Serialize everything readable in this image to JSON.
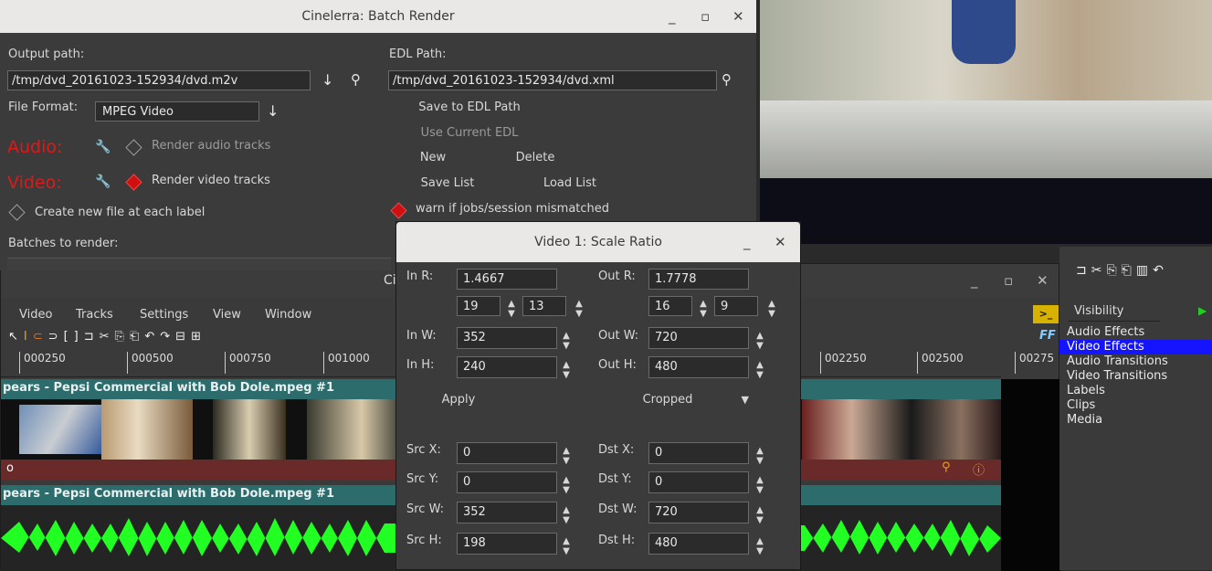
{
  "batch": {
    "title": "Cinelerra: Batch Render",
    "output_label": "Output path:",
    "output_path": "/tmp/dvd_20161023-152934/dvd.m2v",
    "edl_label": "EDL Path:",
    "edl_path": "/tmp/dvd_20161023-152934/dvd.xml",
    "format_label": "File Format:",
    "format_value": "MPEG Video",
    "audio_label": "Audio:",
    "render_audio": "Render audio tracks",
    "video_label": "Video:",
    "render_video": "Render video tracks",
    "create_label": "Create new file at each label",
    "batches_label": "Batches to render:",
    "save_edl": "Save to EDL Path",
    "use_current": "Use Current EDL",
    "new_btn": "New",
    "delete_btn": "Delete",
    "save_list": "Save List",
    "load_list": "Load List",
    "warn": "warn if jobs/session mismatched"
  },
  "main": {
    "title_fragment": "Ci",
    "menu": [
      "Video",
      "Tracks",
      "Settings",
      "View",
      "Window"
    ],
    "ruler_left": [
      "000250",
      "000500",
      "000750",
      "001000"
    ],
    "ruler_right": [
      "002250",
      "002500",
      "00275"
    ],
    "track1_title": "pears - Pepsi Commercial with Bob Dole.mpeg #1",
    "track2_title": "pears - Pepsi Commercial with Bob Dole.mpeg #1",
    "track_marker": "o"
  },
  "resources": {
    "tab": "Visibility",
    "items": [
      "Audio Effects",
      "Video Effects",
      "Audio Transitions",
      "Video Transitions",
      "Labels",
      "Clips",
      "Media"
    ],
    "selected": "Video Effects"
  },
  "scale": {
    "title": "Video 1: Scale Ratio",
    "in_r_label": "In R:",
    "in_r": "1.4667",
    "out_r_label": "Out R:",
    "out_r": "1.7778",
    "in_ra": "19",
    "in_rb": "13",
    "out_ra": "16",
    "out_rb": "9",
    "in_w_label": "In W:",
    "in_w": "352",
    "out_w_label": "Out W:",
    "out_w": "720",
    "in_h_label": "In H:",
    "in_h": "240",
    "out_h_label": "Out H:",
    "out_h": "480",
    "apply": "Apply",
    "mode": "Cropped",
    "src_x_label": "Src X:",
    "src_x": "0",
    "dst_x_label": "Dst X:",
    "dst_x": "0",
    "src_y_label": "Src Y:",
    "src_y": "0",
    "dst_y_label": "Dst Y:",
    "dst_y": "0",
    "src_w_label": "Src W:",
    "src_w": "352",
    "dst_w_label": "Dst W:",
    "dst_w": "720",
    "src_h_label": "Src H:",
    "src_h": "198",
    "dst_h_label": "Dst H:",
    "dst_h": "480"
  },
  "colors": {
    "accent_blue": "#1414ff",
    "waveform": "#22ff22",
    "red": "#e01818"
  }
}
